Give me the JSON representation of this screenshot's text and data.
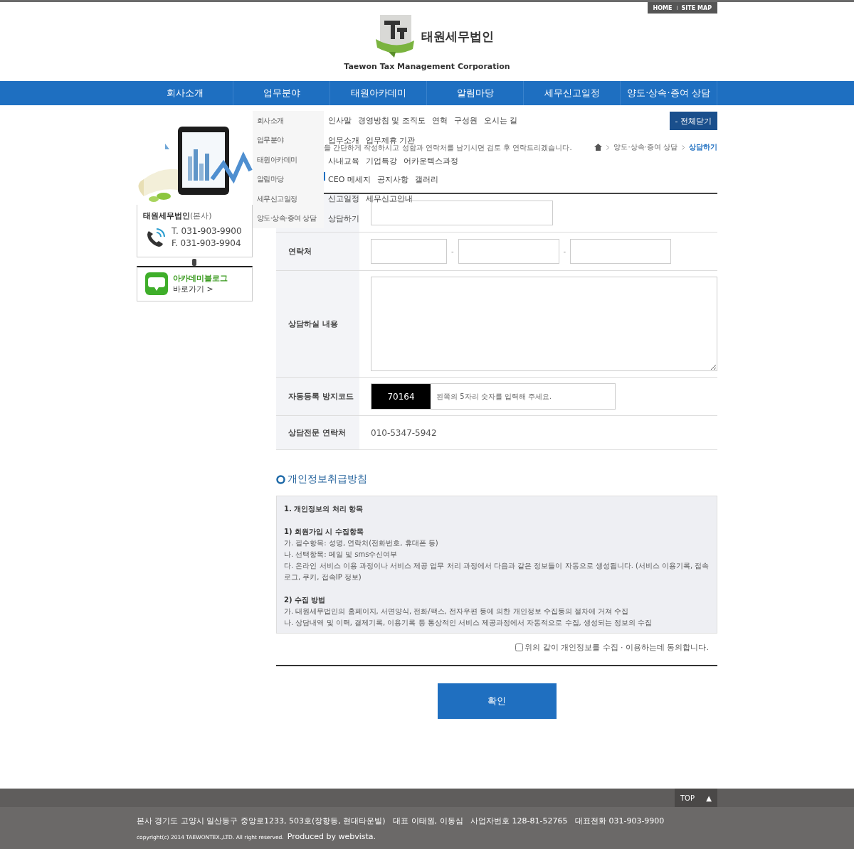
{
  "header": {
    "utility_links": [
      "HOME",
      "SITE MAP"
    ],
    "logo": {
      "name": "태원세무법인",
      "subtitle": "Taewon Tax Management Corporation"
    },
    "nav": [
      "회사소개",
      "업무분야",
      "태원아카데미",
      "알림마당",
      "세무신고일정",
      "양도·상속·증여 상담"
    ]
  },
  "mega_menu": [
    {
      "label": "회사소개",
      "links": [
        "인사말",
        "경영방침 및 조직도",
        "연혁",
        "구성원",
        "오시는 길"
      ]
    },
    {
      "label": "업무분야",
      "links": [
        "업무소개",
        "업무제휴 기관"
      ]
    },
    {
      "label": "태원아카데미",
      "links": [
        "사내교육",
        "기업특강",
        "어카운텍스과정"
      ]
    },
    {
      "label": "알림마당",
      "links": [
        "CEO 메세지",
        "공지사항",
        "갤러리"
      ]
    },
    {
      "label": "세무신고일정",
      "links": [
        "신고일정",
        "세무신고안내"
      ]
    },
    {
      "label": "양도·상속·증여 상담",
      "links": [
        "상담하기"
      ]
    }
  ],
  "close_all_button": "- 전체닫기",
  "description": "을 간단하게 작성하시고 성함과 연락처를 남기시면 검토 후 연락드리겠습니다.",
  "breadcrumb": [
    {
      "label": "양도·상속·증여 상담",
      "selected": false
    },
    {
      "label": "상담하기",
      "selected": true
    }
  ],
  "sidebar": {
    "contact": {
      "company": "태원세무법인",
      "note": "(본사)",
      "tel": "T. 031-903-9900",
      "fax": "F. 031-903-9904"
    },
    "blog": {
      "title": "아카데미블로그",
      "link": "바로가기 >"
    }
  },
  "form": [
    {
      "kind": "text"
    },
    {
      "kind": "phone",
      "label": "연락처",
      "separators": [
        "-",
        "-"
      ]
    },
    {
      "kind": "textarea",
      "label": "상담하실 내용"
    },
    {
      "kind": "captcha",
      "label": "자동등록 방지코드",
      "code": "70164",
      "placeholder": "왼쪽의 5자리 숫자를 입력해 주세요."
    },
    {
      "kind": "static",
      "label": "상담전문 연락처",
      "value": "010-5347-5942"
    }
  ],
  "privacy": {
    "title": "개인정보취급방침",
    "lines": [
      {
        "kind": "heading",
        "text": "1. 개인정보의 처리 항목"
      },
      {
        "kind": "heading",
        "text": "1) 회원가입 시 수집항목"
      },
      {
        "kind": "text",
        "text": "가. 필수항목: 성명, 연락처(전화번호, 휴대폰 등)"
      },
      {
        "kind": "text",
        "text": "나. 선택항목: 메일 및 sms수신여부"
      },
      {
        "kind": "text",
        "text": "다. 온라인 서비스 이용 과정이나 서비스 제공 업무 처리 과정에서 다음과 같은 정보들이 자동으로 생성됩니다. (서비스 이용기록, 접속 로그, 쿠키, 접속IP 정보)"
      },
      {
        "kind": "heading",
        "text": "2) 수집 방법"
      },
      {
        "kind": "text",
        "text": "가. 태원세무법인의 홈페이지, 서면양식, 전화/팩스, 전자우편 등에 의한 개인정보 수집등의 절차에 거쳐 수집"
      },
      {
        "kind": "text",
        "text": "나. 상담내역 및 이력, 결제기록, 이용기록 등 통상적인 서비스 제공과정에서 자동적으로 수집, 생성되는 정보의 수집"
      }
    ],
    "consent": {
      "label": "위의 같이 개인정보를 수집 · 이용하는데 동의합니다.",
      "checked": false
    }
  },
  "submit_button": "확인",
  "footer": {
    "top_button": "TOP",
    "top_icon": "▲",
    "address": "본사 경기도 고양시 일산동구 중앙로1233, 503호(장항동, 현대타운빌)   대표 이태원, 이동심   사업자번호 128-81-52765   대표전화 031-903-9900",
    "copyright": "copyright(c) 2014 TAEWONTEX.,LTD. All right reserved.",
    "credit": "Produced by webvista."
  }
}
